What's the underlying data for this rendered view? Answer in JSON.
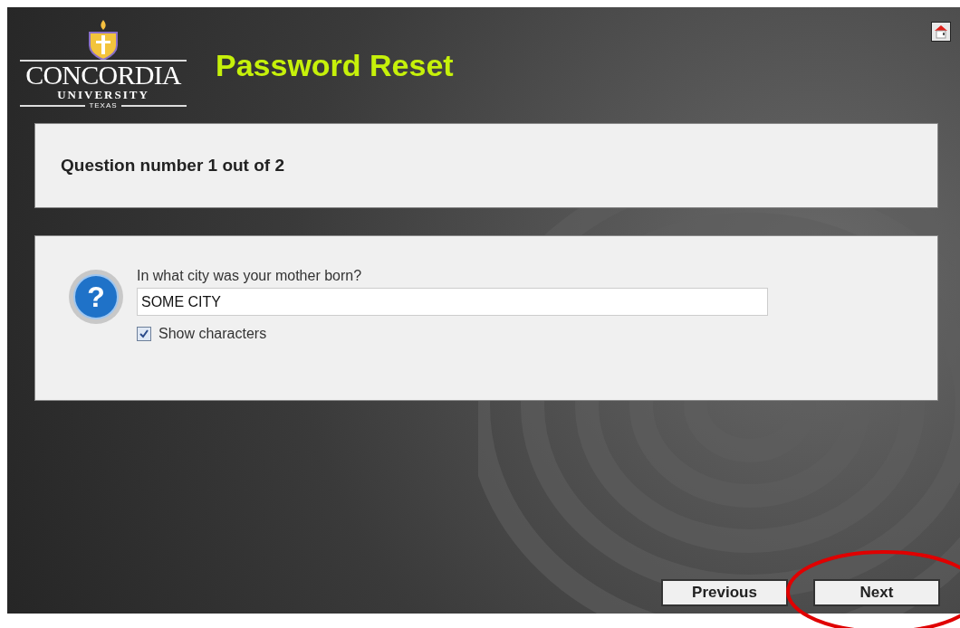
{
  "logo": {
    "name": "CONCORDIA",
    "line_2": "UNIVERSITY",
    "line_3": "TEXAS"
  },
  "title": "Password Reset",
  "progress": "Question number 1 out of 2",
  "question": {
    "icon_glyph": "?",
    "label": "In what city was your mother born?",
    "value": "SOME CITY",
    "show_characters": {
      "label": "Show characters",
      "checked": true
    }
  },
  "buttons": [
    {
      "label": "Previous"
    },
    {
      "label": "Next",
      "circled_in_red": true
    }
  ]
}
